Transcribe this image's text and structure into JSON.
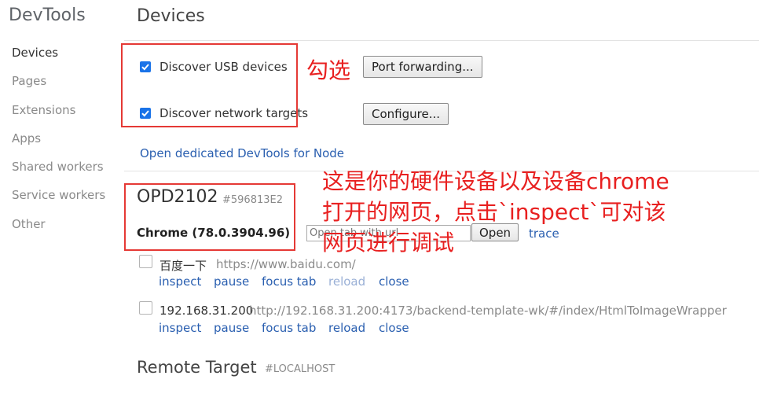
{
  "sidebar": {
    "app_title": "DevTools",
    "items": [
      {
        "label": "Devices",
        "active": true
      },
      {
        "label": "Pages"
      },
      {
        "label": "Extensions"
      },
      {
        "label": "Apps"
      },
      {
        "label": "Shared workers"
      },
      {
        "label": "Service workers"
      },
      {
        "label": "Other"
      }
    ]
  },
  "main": {
    "title": "Devices",
    "discover_usb": {
      "label": "Discover USB devices",
      "checked": true
    },
    "discover_network": {
      "label": "Discover network targets",
      "checked": true
    },
    "port_forwarding_button": "Port forwarding...",
    "configure_button": "Configure...",
    "node_link": "Open dedicated DevTools for Node"
  },
  "device": {
    "name": "OPD2102",
    "serial": "#596813E2",
    "browser": "Chrome (78.0.3904.96)",
    "url_input_placeholder": "Open tab with url",
    "open_button": "Open",
    "trace_link": "trace",
    "pages": [
      {
        "title": "百度一下",
        "url": "https://www.baidu.com/",
        "actions": {
          "inspect": "inspect",
          "pause": "pause",
          "focus": "focus tab",
          "reload": "reload",
          "close": "close"
        },
        "reload_disabled": true
      },
      {
        "title": "192.168.31.200",
        "url": "http://192.168.31.200:4173/backend-template-wk/#/index/HtmlToImageWrapper",
        "actions": {
          "inspect": "inspect",
          "pause": "pause",
          "focus": "focus tab",
          "reload": "reload",
          "close": "close"
        },
        "reload_disabled": false
      }
    ]
  },
  "remote": {
    "title": "Remote Target",
    "subtitle": "#LOCALHOST"
  },
  "annotations": {
    "check_note": "勾选",
    "device_note_line1": "这是你的硬件设备以及设备chrome",
    "device_note_line2": "打开的网页，点击`inspect`可对该",
    "device_note_line3": "网页进行调试",
    "color": "#e53935"
  },
  "colors": {
    "accent": "#1a73e8",
    "link": "#2a5fb0",
    "link_disabled": "#9ab0d6"
  }
}
